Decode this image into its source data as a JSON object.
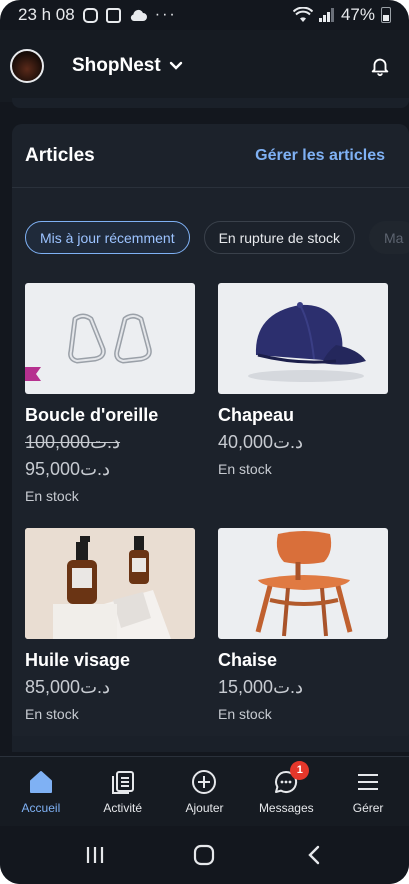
{
  "status_bar": {
    "time": "23 h 08",
    "dots": "···",
    "battery": "47%"
  },
  "header": {
    "store_name": "ShopNest"
  },
  "articles": {
    "title": "Articles",
    "manage_link": "Gérer les articles",
    "filters": [
      "Mis à jour récemment",
      "En rupture de stock",
      "Ma"
    ],
    "products": [
      {
        "name": "Boucle d'oreille",
        "old_price": "د.ت100,000",
        "price": "د.ت95,000",
        "stock": "En stock"
      },
      {
        "name": "Chapeau",
        "old_price": "",
        "price": "د.ت40,000",
        "stock": "En stock"
      },
      {
        "name": "Huile visage",
        "old_price": "",
        "price": "د.ت85,000",
        "stock": "En stock"
      },
      {
        "name": "Chaise",
        "old_price": "",
        "price": "د.ت15,000",
        "stock": "En stock"
      }
    ]
  },
  "bottom_nav": {
    "items": [
      {
        "label": "Accueil",
        "active": true
      },
      {
        "label": "Activité",
        "active": false
      },
      {
        "label": "Ajouter",
        "active": false
      },
      {
        "label": "Messages",
        "active": false,
        "badge": "1"
      },
      {
        "label": "Gérer",
        "active": false
      }
    ]
  },
  "colors": {
    "accent": "#7fb1f4",
    "background": "#13171e",
    "card": "#1c222b",
    "badge": "#e5372b"
  }
}
